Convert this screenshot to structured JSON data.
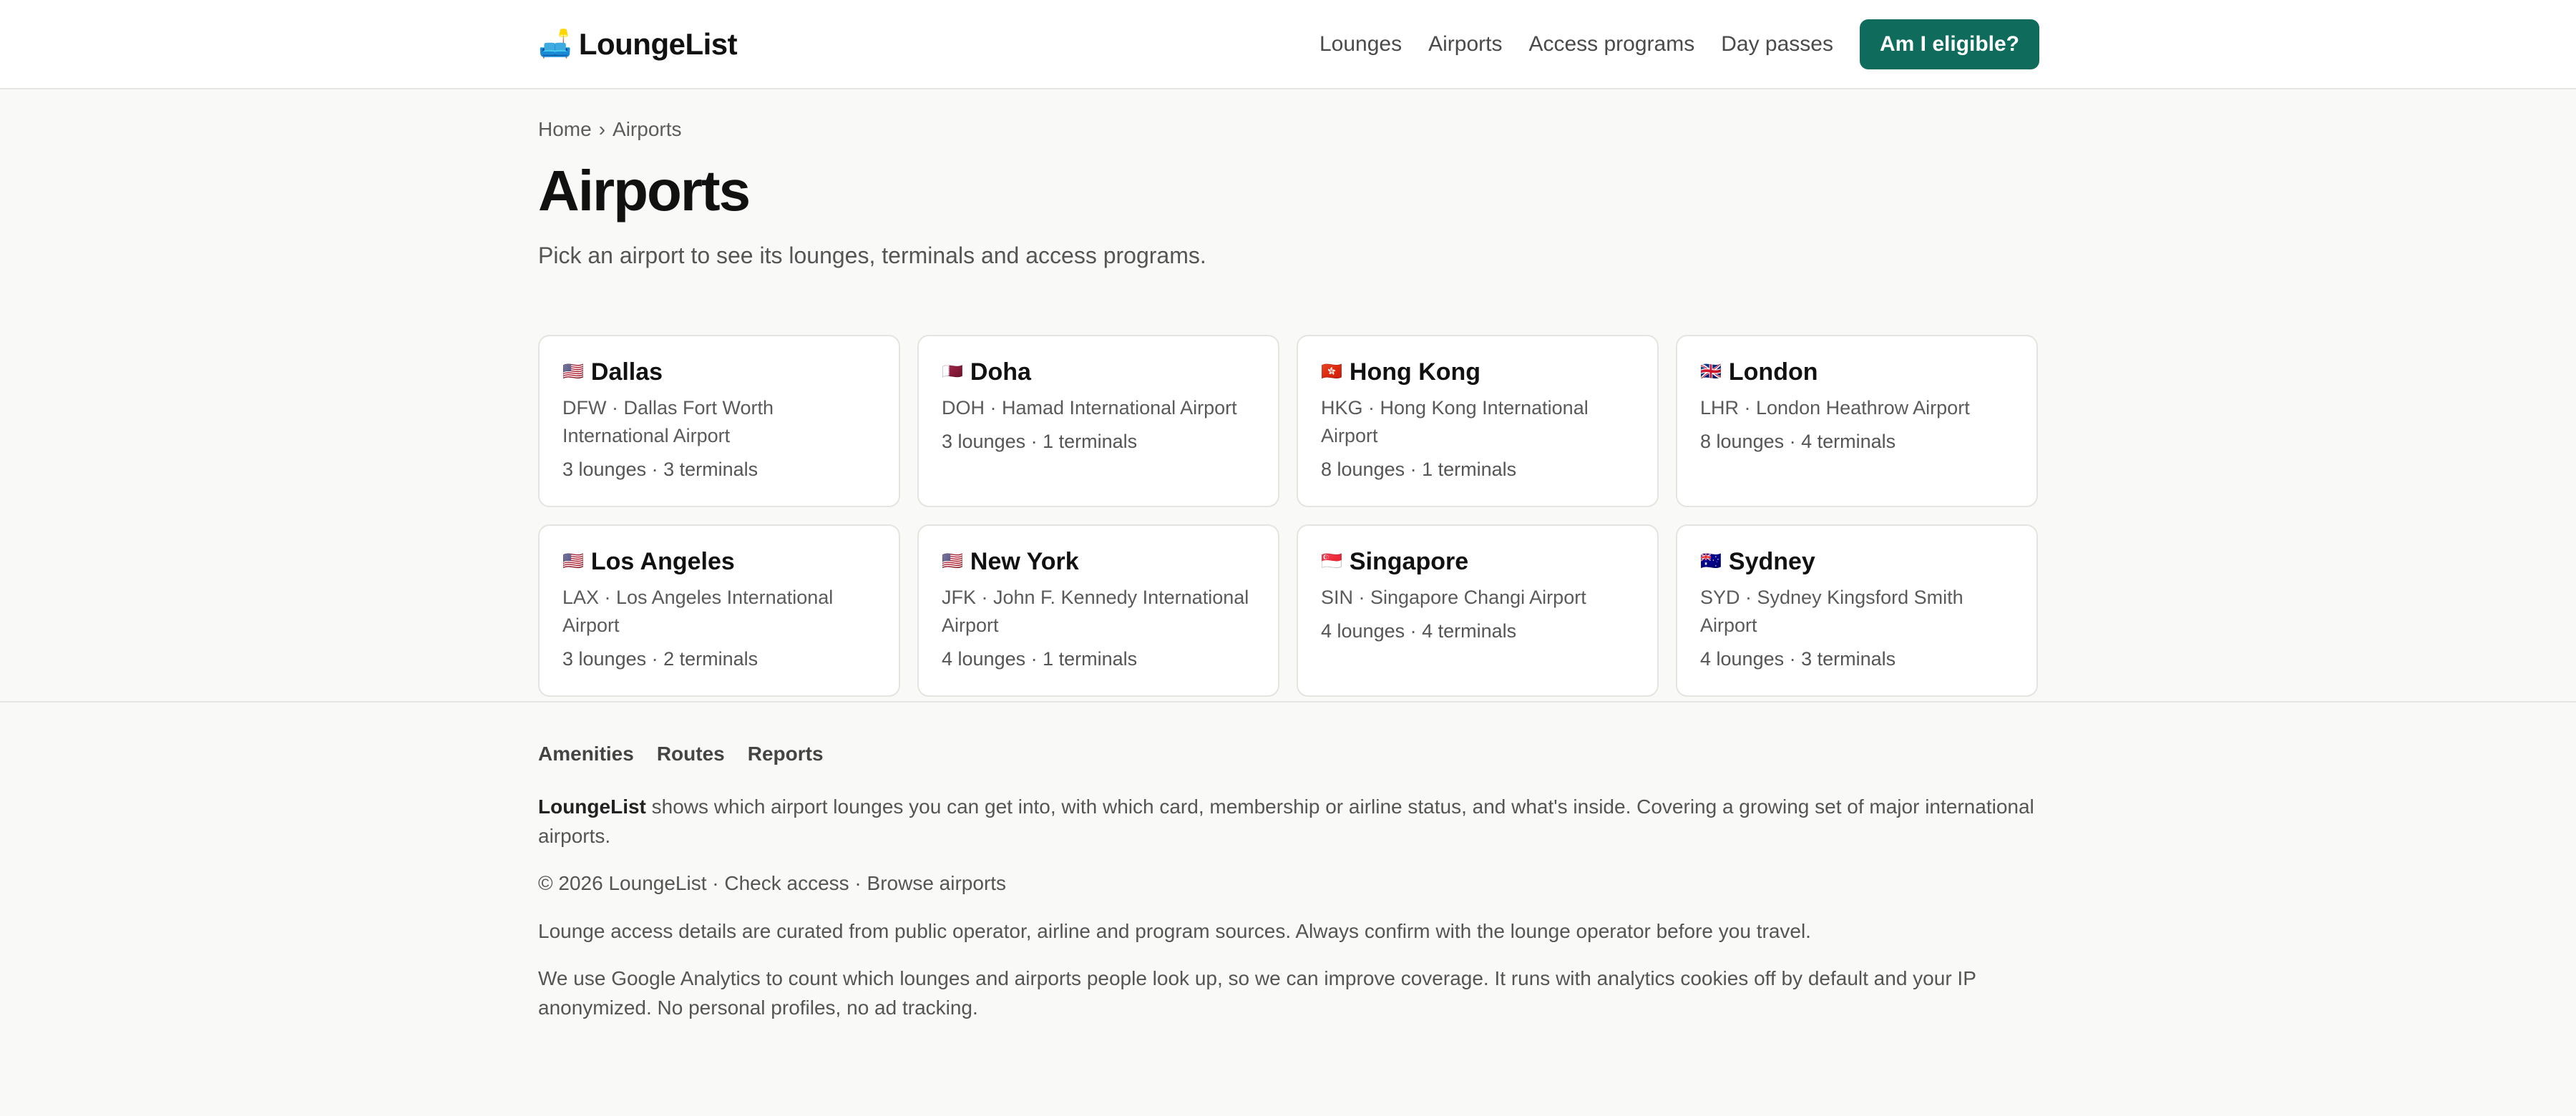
{
  "brand": {
    "logo_icon": "🛋️",
    "name": "LoungeList"
  },
  "nav": {
    "items": [
      "Lounges",
      "Airports",
      "Access programs",
      "Day passes"
    ],
    "cta": "Am I eligible?"
  },
  "breadcrumb": {
    "home": "Home",
    "sep": "›",
    "current": "Airports"
  },
  "page": {
    "title": "Airports",
    "lead": "Pick an airport to see its lounges, terminals and access programs."
  },
  "airports": [
    {
      "flag": "🇺🇸",
      "city": "Dallas",
      "detail": "DFW · Dallas Fort Worth International Airport",
      "meta": "3 lounges · 3 terminals"
    },
    {
      "flag": "🇶🇦",
      "city": "Doha",
      "detail": "DOH · Hamad International Airport",
      "meta": "3 lounges · 1 terminals"
    },
    {
      "flag": "🇭🇰",
      "city": "Hong Kong",
      "detail": "HKG · Hong Kong International Airport",
      "meta": "8 lounges · 1 terminals"
    },
    {
      "flag": "🇬🇧",
      "city": "London",
      "detail": "LHR · London Heathrow Airport",
      "meta": "8 lounges · 4 terminals"
    },
    {
      "flag": "🇺🇸",
      "city": "Los Angeles",
      "detail": "LAX · Los Angeles International Airport",
      "meta": "3 lounges · 2 terminals"
    },
    {
      "flag": "🇺🇸",
      "city": "New York",
      "detail": "JFK · John F. Kennedy International Airport",
      "meta": "4 lounges · 1 terminals"
    },
    {
      "flag": "🇸🇬",
      "city": "Singapore",
      "detail": "SIN · Singapore Changi Airport",
      "meta": "4 lounges · 4 terminals"
    },
    {
      "flag": "🇦🇺",
      "city": "Sydney",
      "detail": "SYD · Sydney Kingsford Smith Airport",
      "meta": "4 lounges · 3 terminals"
    }
  ],
  "footer": {
    "links": [
      "Amenities",
      "Routes",
      "Reports"
    ],
    "about_brand": "LoungeList",
    "about_text": " shows which airport lounges you can get into, with which card, membership or airline status, and what's inside. Covering a growing set of major international airports.",
    "copyright": "© 2026 LoungeList · Check access · Browse airports",
    "disclaimer": "Lounge access details are curated from public operator, airline and program sources. Always confirm with the lounge operator before you travel.",
    "analytics": "We use Google Analytics to count which lounges and airports people look up, so we can improve coverage. It runs with analytics cookies off by default and your IP anonymized. No personal profiles, no ad tracking."
  }
}
